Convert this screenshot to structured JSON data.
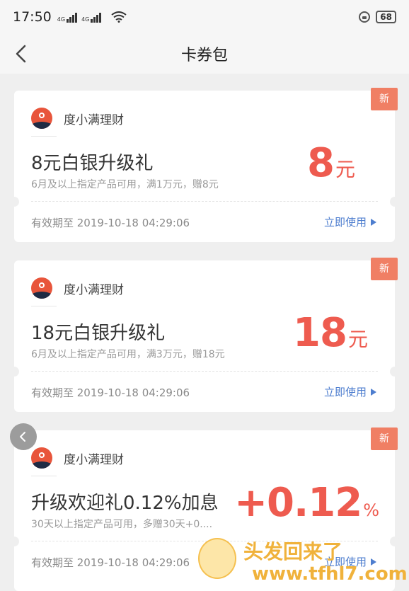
{
  "status": {
    "time": "17:50",
    "net_label": "4G",
    "battery": "68"
  },
  "nav": {
    "title": "卡券包"
  },
  "coupons": [
    {
      "badge": "新",
      "brand": "度小满理财",
      "title": "8元白银升级礼",
      "desc": "6月及以上指定产品可用，满1万元，赠8元",
      "amount": "8",
      "unit": "元",
      "expiry": "有效期至 2019-10-18 04:29:06",
      "action": "立即使用"
    },
    {
      "badge": "新",
      "brand": "度小满理财",
      "title": "18元白银升级礼",
      "desc": "6月及以上指定产品可用，满3万元，赠18元",
      "amount": "18",
      "unit": "元",
      "expiry": "有效期至 2019-10-18 04:29:06",
      "action": "立即使用"
    },
    {
      "badge": "新",
      "brand": "度小满理财",
      "title": "升级欢迎礼0.12%加息",
      "desc": "30天以上指定产品可用，多赠30天+0....",
      "amount": "+0.12",
      "unit": "%",
      "expiry": "有效期至 2019-10-18 04:29:06",
      "action": "立即使用"
    }
  ],
  "watermark": {
    "text": "头发回来了",
    "url": "www.tfhl7.com"
  },
  "colors": {
    "accent_red": "#ee5b4f",
    "badge_orange": "#f07f64",
    "link_blue": "#4e7ecf",
    "brand_red": "#e8553b"
  }
}
